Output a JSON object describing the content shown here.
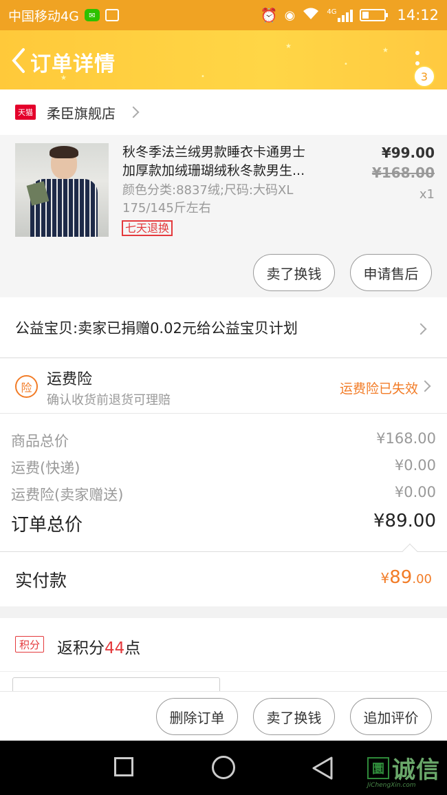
{
  "status_bar": {
    "carrier": "中国移动4G",
    "wechat_icon": "wechat-icon",
    "network_label": "4G",
    "time": "14:12"
  },
  "header": {
    "title": "订单详情",
    "badge_count": "3"
  },
  "store": {
    "platform_icon_text": "天猫",
    "name": "柔臣旗舰店"
  },
  "product": {
    "title_line1": "秋冬季法兰绒男款睡衣卡通男士",
    "title_line2": "加厚款加绒珊瑚绒秋冬款男生...",
    "sku_line1": "颜色分类:8837绒;尺码:大码XL",
    "sku_line2": "175/145斤左右",
    "tag": "七天退换",
    "price": "¥99.00",
    "original_price": "¥168.00",
    "quantity": "x1",
    "sell_button": "卖了换钱",
    "aftersale_button": "申请售后"
  },
  "charity": {
    "text": "公益宝贝:卖家已捐赠0.02元给公益宝贝计划"
  },
  "insurance": {
    "icon_text": "险",
    "title": "运费险",
    "subtitle": "确认收货前退货可理赔",
    "status": "运费险已失效"
  },
  "totals": {
    "rows": [
      {
        "label": "商品总价",
        "value": "¥168.00"
      },
      {
        "label": "运费(快递)",
        "value": "¥0.00"
      },
      {
        "label": "运费险(卖家赠送)",
        "value": "¥0.00"
      }
    ],
    "order_total_label": "订单总价",
    "order_total_value": "¥89.00"
  },
  "paid": {
    "label": "实付款",
    "currency": "¥",
    "integer": "89",
    "decimal": ".00"
  },
  "points": {
    "tag": "积分",
    "prefix": "返积分",
    "count": "44",
    "suffix": "点"
  },
  "actions": {
    "delete": "删除订单",
    "sell": "卖了换钱",
    "review": "追加评价"
  },
  "watermark": {
    "logo": "圜",
    "text": "诚信",
    "sub": "JiChengXin.com"
  },
  "colors": {
    "status_bar": "#f0a323",
    "header": "#ffd646",
    "accent_orange": "#f27c27",
    "tmall_red": "#e4002b"
  }
}
